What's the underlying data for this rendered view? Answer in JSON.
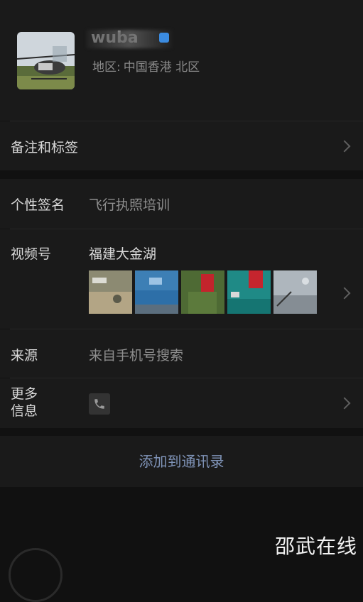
{
  "profile": {
    "name": "wuba",
    "region_label": "地区:",
    "region_value": "中国香港 北区"
  },
  "rows": {
    "remark_label": "备注和标签",
    "signature_label": "个性签名",
    "signature_value": "飞行执照培训",
    "channels_label": "视频号",
    "channels_value": "福建大金湖",
    "source_label": "来源",
    "source_value": "来自手机号搜索",
    "more_label_line1": "更多",
    "more_label_line2": "信息"
  },
  "actions": {
    "add_contact": "添加到通讯录"
  },
  "watermark": "邵武在线",
  "colors": {
    "background": "#111111",
    "panel": "#1a1a1a",
    "link": "#7f93b7",
    "secondary_text": "#8e8e8e"
  },
  "icons": [
    "helicopter-avatar",
    "gender-icon",
    "chevron-right-icon",
    "phone-icon"
  ]
}
